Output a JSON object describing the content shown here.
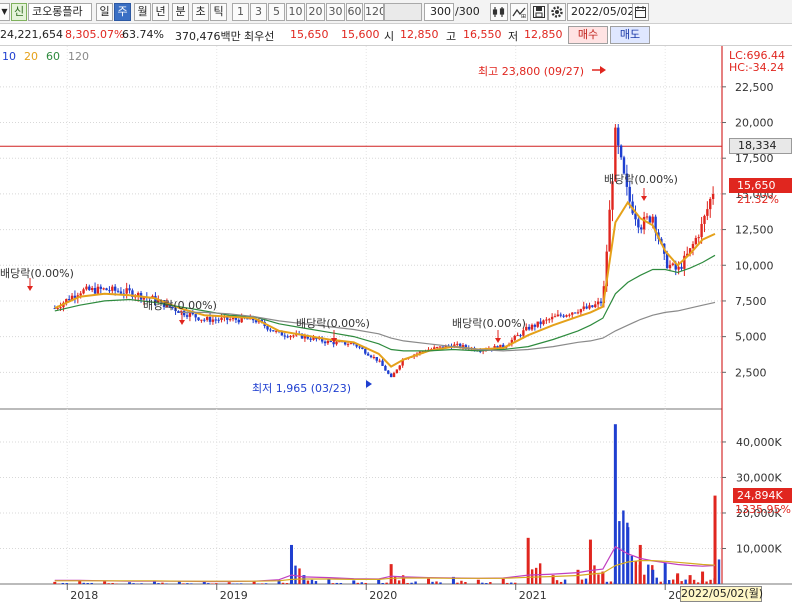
{
  "toolbar": {
    "dropdown_arrow": "▼",
    "badge": "신",
    "stock_name": "코오롱플라",
    "periods": [
      {
        "label": "일",
        "active": false
      },
      {
        "label": "주",
        "active": true
      },
      {
        "label": "월",
        "active": false
      },
      {
        "label": "년",
        "active": false
      },
      {
        "label": "분",
        "active": false
      },
      {
        "label": "초",
        "active": false
      },
      {
        "label": "틱",
        "active": false
      }
    ],
    "intervals": [
      "1",
      "3",
      "5",
      "10",
      "20",
      "30",
      "60",
      "120"
    ],
    "count_value": "300",
    "count_total": "/300",
    "date_value": "2022/05/02"
  },
  "quote": {
    "volume": "24,221,654",
    "change_rate": "8,305.07%",
    "turnover": "63.74%",
    "amount": "370,476백만",
    "best_ask_label": "최우선",
    "best_ask": "15,650",
    "best_bid": "15,600",
    "open_label": "시",
    "open": "12,850",
    "high_label": "고",
    "high": "16,550",
    "low_label": "저",
    "low": "12,850",
    "buy_label": "매수",
    "sell_label": "매도"
  },
  "colors": {
    "up": "#e0261f",
    "down": "#1f3fd0",
    "ma5": "#555555",
    "ma10": "#1f3fd0",
    "ma20": "#e5a11a",
    "ma60": "#2e8b3e",
    "ma120": "#8a8a8a"
  },
  "price_chart": {
    "legend": [
      {
        "label": "10",
        "color": "#1f3fd0"
      },
      {
        "label": "20",
        "color": "#e5a11a"
      },
      {
        "label": "60",
        "color": "#2e8b3e"
      },
      {
        "label": "120",
        "color": "#8a8a8a"
      }
    ],
    "lc_label": "LC:696.44",
    "hc_label": "HC:-34.24",
    "max_annotation": "최고 23,800 (09/27)",
    "min_annotation": "최저 1,965 (03/23)",
    "dividend_labels": [
      "배당락(0.00%)",
      "배당락(0.00%)",
      "배당락(0.00%)",
      "배당락(0.00%)",
      "배당락(0.00%)"
    ],
    "crosshair_price": "18,334",
    "current_price": "15,650",
    "current_change": "21.32%"
  },
  "volume_chart": {
    "current_volume": "24,894K",
    "current_change": "1335.95%"
  },
  "x_axis": {
    "cursor_date": "2022/05/02(월)"
  },
  "chart_data": [
    {
      "type": "candlestick",
      "title": "",
      "x_ticks": [
        "2018",
        "2019",
        "2020",
        "2021",
        "2022"
      ],
      "y_ticks": [
        "2,500",
        "5,000",
        "7,500",
        "10,000",
        "12,500",
        "15,000",
        "17,500",
        "20,000",
        "22,500"
      ],
      "ylim": [
        0,
        24800
      ],
      "x": [
        "2017-12",
        "2018-02",
        "2018-04",
        "2018-06",
        "2018-08",
        "2018-10",
        "2018-12",
        "2019-02",
        "2019-04",
        "2019-06",
        "2019-08",
        "2019-10",
        "2019-12",
        "2020-02",
        "2020-03",
        "2020-04",
        "2020-06",
        "2020-08",
        "2020-10",
        "2020-12",
        "2021-02",
        "2021-04",
        "2021-06",
        "2021-07",
        "2021-08",
        "2021-09",
        "2021-10",
        "2021-11",
        "2021-12",
        "2022-01",
        "2022-02",
        "2022-03",
        "2022-04",
        "2022-05"
      ],
      "close": [
        7000,
        8200,
        8300,
        8100,
        7600,
        6800,
        6200,
        6200,
        6200,
        5200,
        5000,
        4600,
        4500,
        3300,
        2100,
        3500,
        4100,
        4400,
        4100,
        4300,
        5600,
        6300,
        6900,
        7000,
        7500,
        19000,
        14800,
        12800,
        13500,
        10200,
        9600,
        11000,
        12850,
        15650
      ],
      "series": [
        {
          "name": "20",
          "values": [
            7000,
            7800,
            8000,
            7900,
            7700,
            7000,
            6500,
            6400,
            6300,
            5400,
            5100,
            4800,
            4600,
            3800,
            2900,
            3400,
            4000,
            4300,
            4100,
            4200,
            5100,
            5800,
            6400,
            6700,
            7100,
            13000,
            14400,
            13300,
            12800,
            11000,
            10000,
            10800,
            11800,
            12200
          ]
        },
        {
          "name": "60",
          "values": [
            6800,
            7200,
            7500,
            7600,
            7400,
            7100,
            6800,
            6500,
            6400,
            5900,
            5600,
            5300,
            5000,
            4500,
            4100,
            4000,
            4000,
            4100,
            4000,
            4100,
            4300,
            4800,
            5400,
            5800,
            6300,
            8000,
            8800,
            9300,
            9700,
            9700,
            9500,
            9800,
            10200,
            10700
          ]
        },
        {
          "name": "120",
          "values": [
            null,
            null,
            null,
            null,
            null,
            6700,
            6700,
            6600,
            6400,
            6100,
            5900,
            5700,
            5500,
            5200,
            4900,
            4700,
            4500,
            4300,
            4100,
            4000,
            4100,
            4300,
            4600,
            4700,
            4900,
            5400,
            5800,
            6200,
            6500,
            6700,
            6800,
            7000,
            7200,
            7400
          ]
        }
      ],
      "legend": "top-left"
    },
    {
      "type": "bar",
      "title": "",
      "y_ticks": [
        "10,000K",
        "20,000K",
        "30,000K",
        "40,000K"
      ],
      "ylim": [
        0,
        49000
      ],
      "x": [
        "2017-12",
        "2018-02",
        "2018-04",
        "2018-06",
        "2018-08",
        "2018-10",
        "2018-12",
        "2019-02",
        "2019-04",
        "2019-06",
        "2019-07",
        "2019-08",
        "2019-10",
        "2019-12",
        "2020-02",
        "2020-03",
        "2020-04",
        "2020-06",
        "2020-08",
        "2020-10",
        "2020-12",
        "2021-02",
        "2021-04",
        "2021-06",
        "2021-07",
        "2021-08",
        "2021-09",
        "2021-10",
        "2021-11",
        "2021-12",
        "2022-01",
        "2022-02",
        "2022-03",
        "2022-04",
        "2022-05"
      ],
      "values": [
        600,
        900,
        700,
        500,
        800,
        700,
        600,
        500,
        700,
        1100,
        11000,
        2500,
        1300,
        1000,
        1200,
        5600,
        1800,
        1500,
        2000,
        1200,
        1500,
        13000,
        2500,
        4000,
        12500,
        3500,
        45000,
        16000,
        11000,
        4000,
        6000,
        3000,
        2500,
        3500,
        24894
      ],
      "series": [
        {
          "name": "line1",
          "values": [
            1000,
            1000,
            900,
            800,
            800,
            800,
            700,
            700,
            800,
            1200,
            2500,
            2000,
            1800,
            1500,
            1400,
            2200,
            2000,
            1800,
            1700,
            1600,
            1700,
            2500,
            2800,
            3200,
            3800,
            4200,
            10500,
            8500,
            7200,
            6500,
            6000,
            5500,
            5200,
            5000,
            5200
          ]
        },
        {
          "name": "line2",
          "values": [
            900,
            900,
            900,
            900,
            900,
            800,
            800,
            800,
            800,
            900,
            1300,
            1400,
            1400,
            1300,
            1300,
            1600,
            1700,
            1700,
            1600,
            1600,
            1600,
            1900,
            2100,
            2400,
            2800,
            3100,
            5200,
            6200,
            6600,
            6600,
            6400,
            6100,
            5800,
            5500,
            5300
          ]
        }
      ]
    }
  ]
}
